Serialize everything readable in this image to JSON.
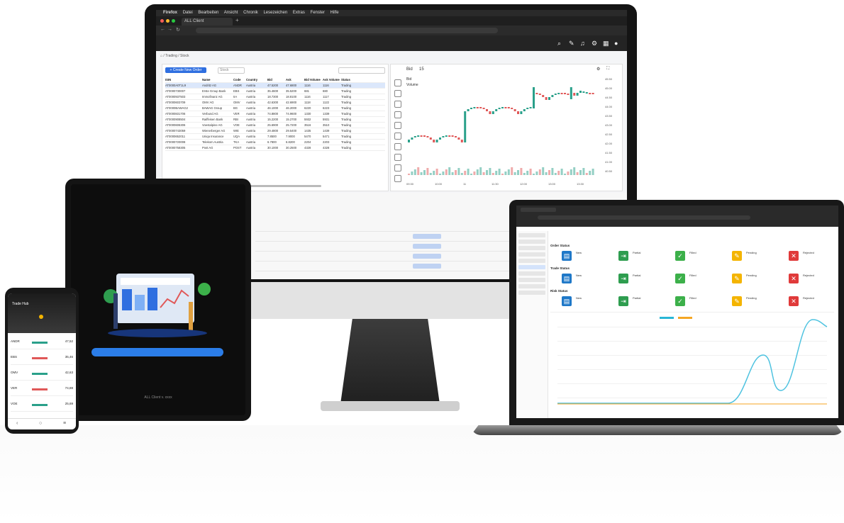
{
  "monitor": {
    "menubar": [
      "Firefox",
      "Datei",
      "Bearbeiten",
      "Ansicht",
      "Chronik",
      "Lesezeichen",
      "Extras",
      "Fenster",
      "Hilfe"
    ],
    "tab_title": "ALL Client",
    "toolbar_icons": [
      "search-icon",
      "wrench-icon",
      "bell-icon",
      "gear-icon",
      "grid-icon",
      "user-icon"
    ],
    "table_button": "+ Create New Order",
    "table_filter": "Stock",
    "table_columns": [
      "ISIN",
      "Name",
      "Code",
      "Country",
      "Bid",
      "Ask",
      "Bid Volume",
      "Ask Volume",
      "Status"
    ],
    "table_rows": [
      [
        "AT0000A0T1L9",
        "Andritz AG",
        "ANDR",
        "Austria",
        "47.5200",
        "47.6800",
        "1116",
        "1116",
        "Trading"
      ],
      [
        "AT0000730007",
        "Erste Group Bank",
        "EBS",
        "Austria",
        "35.4600",
        "35.5200",
        "681",
        "680",
        "Trading"
      ],
      [
        "AT0000937503",
        "Immofinanz AG",
        "IIA",
        "Austria",
        "18.7300",
        "18.8100",
        "1116",
        "1117",
        "Trading"
      ],
      [
        "AT0000603709",
        "OMV AG",
        "OMV",
        "Austria",
        "42.6300",
        "42.6900",
        "1118",
        "1122",
        "Trading"
      ],
      [
        "AT0000BAWAG2",
        "BAWAG Group",
        "BG",
        "Austria",
        "46.1000",
        "46.2000",
        "6220",
        "6223",
        "Trading"
      ],
      [
        "AT0000831706",
        "Verbund AG",
        "VER",
        "Austria",
        "74.8800",
        "74.9600",
        "1330",
        "1339",
        "Trading"
      ],
      [
        "AT0000908504",
        "Raiffeisen Bank",
        "RBI",
        "Austria",
        "15.2200",
        "15.2700",
        "5932",
        "5931",
        "Trading"
      ],
      [
        "AT0000606306",
        "Voestalpine AG",
        "VOE",
        "Austria",
        "25.6900",
        "25.7200",
        "3516",
        "3510",
        "Trading"
      ],
      [
        "AT0000743059",
        "Wienerberger AG",
        "WIE",
        "Austria",
        "29.4800",
        "29.5400",
        "1435",
        "1439",
        "Trading"
      ],
      [
        "AT0000652011",
        "Uniqa Insurance",
        "UQA",
        "Austria",
        "7.8500",
        "7.9000",
        "5470",
        "5471",
        "Trading"
      ],
      [
        "AT0000720008",
        "Telekom Austria",
        "TKA",
        "Austria",
        "6.7800",
        "6.8200",
        "2204",
        "2203",
        "Trading"
      ],
      [
        "AT0000758305",
        "Post AG",
        "POST",
        "Austria",
        "30.1000",
        "30.2500",
        "4328",
        "4328",
        "Trading"
      ]
    ],
    "chart_symbol": "Bid",
    "chart_interval": "15",
    "chart_label": "Volume",
    "chart_note": "Bid",
    "price_labels": [
      "45.50",
      "45.00",
      "44.50",
      "44.00",
      "43.50",
      "43.00",
      "42.50",
      "42.00",
      "41.50",
      "41.00",
      "40.50"
    ],
    "time_labels": [
      "09:30",
      "10:00",
      "11",
      "11:30",
      "12:00",
      "13:00",
      "13:30"
    ]
  },
  "tablet": {
    "button_label": "",
    "footer_text": "ALL Client v. xxxx"
  },
  "phone": {
    "header_title": "Trade Hub",
    "rows": [
      {
        "name": "ANDR",
        "price": "47,52"
      },
      {
        "name": "EBS",
        "price": "35,46"
      },
      {
        "name": "OMV",
        "price": "42,63"
      },
      {
        "name": "VER",
        "price": "74,88"
      },
      {
        "name": "VOE",
        "price": "25,69"
      }
    ]
  },
  "laptop": {
    "sections": [
      "Order Status",
      "Trade Status",
      "Risk Status"
    ],
    "card_labels": [
      "New",
      "Partial",
      "Filled",
      "Pending",
      "Rejected"
    ],
    "card_colors": [
      "#1f78c8",
      "#2e9d4f",
      "#3cb04a",
      "#f4b400",
      "#e03a3a"
    ],
    "card_icons": [
      "document-icon",
      "exit-icon",
      "check-icon",
      "edit-icon",
      "cancel-icon"
    ],
    "chart_legend_colors": [
      "#29b6d6",
      "#f5a623"
    ]
  },
  "colors": {
    "accent": "#2f6fe0",
    "candle_up": "#2aa08a",
    "candle_down": "#e05858",
    "curve": "#4fc3e0",
    "curve2": "#f5a623"
  }
}
